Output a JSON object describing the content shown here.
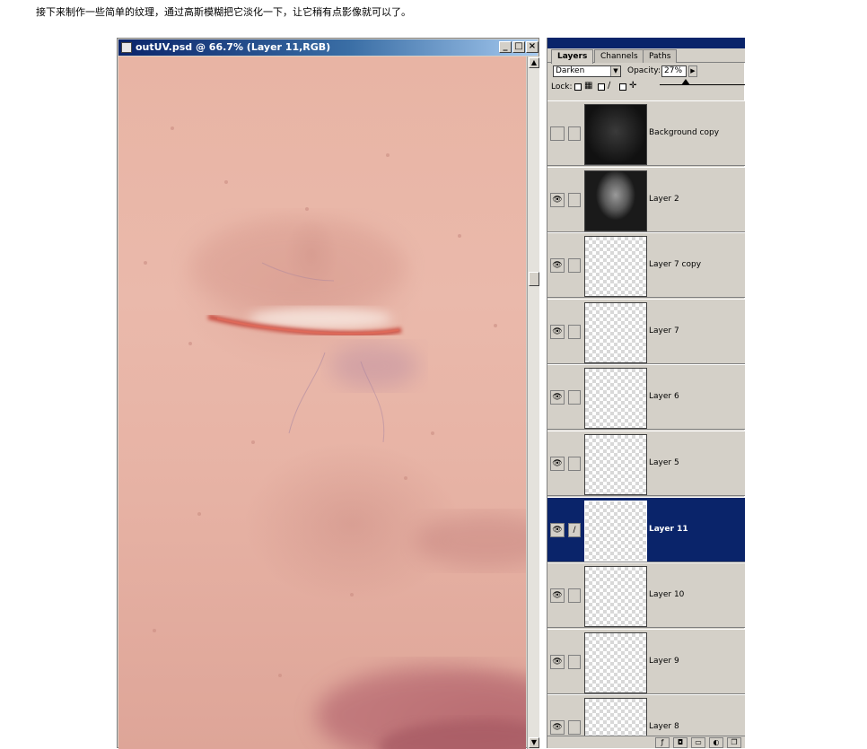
{
  "caption": "接下来制作一些简单的纹理，通过高斯模糊把它淡化一下，让它稍有点影像就可以了。",
  "document": {
    "title": "outUV.psd @ 66.7% (Layer 11,RGB)",
    "buttons": {
      "minimize": "_",
      "maximize": "□",
      "close": "×"
    }
  },
  "layers_panel": {
    "tabs": [
      "Layers",
      "Channels",
      "Paths"
    ],
    "blend_mode": "Darken",
    "opacity_label": "Opacity:",
    "opacity_value": "27%",
    "lock_label": "Lock:",
    "layers": [
      {
        "name": "Background copy",
        "visible": false,
        "thumb": "dark"
      },
      {
        "name": "Layer 2",
        "visible": true,
        "thumb": "face"
      },
      {
        "name": "Layer 7 copy",
        "visible": true,
        "thumb": "transparent"
      },
      {
        "name": "Layer 7",
        "visible": true,
        "thumb": "transparent"
      },
      {
        "name": "Layer 6",
        "visible": true,
        "thumb": "transparent"
      },
      {
        "name": "Layer 5",
        "visible": true,
        "thumb": "transparent"
      },
      {
        "name": "Layer 11",
        "visible": true,
        "thumb": "transparent",
        "selected": true
      },
      {
        "name": "Layer 10",
        "visible": true,
        "thumb": "transparent"
      },
      {
        "name": "Layer 9",
        "visible": true,
        "thumb": "transparent"
      },
      {
        "name": "Layer 8",
        "visible": true,
        "thumb": "transparent"
      }
    ]
  }
}
